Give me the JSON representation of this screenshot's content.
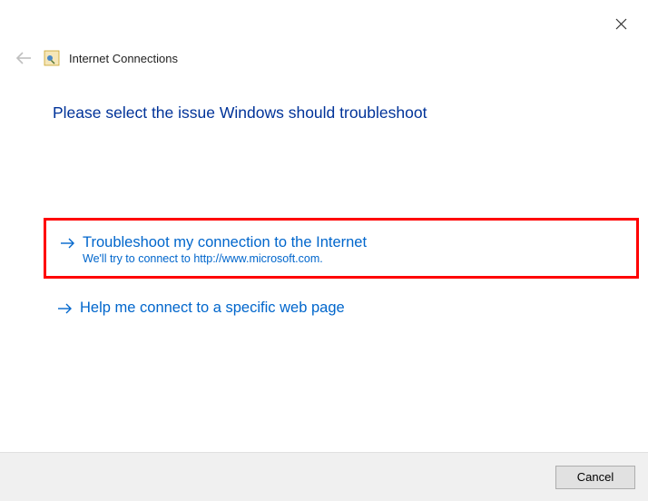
{
  "window_title": "Internet Connections",
  "heading": "Please select the issue Windows should troubleshoot",
  "options": [
    {
      "title": "Troubleshoot my connection to the Internet",
      "subtitle": "We'll try to connect to http://www.microsoft.com.",
      "highlighted": true
    },
    {
      "title": "Help me connect to a specific web page",
      "subtitle": "",
      "highlighted": false
    }
  ],
  "footer": {
    "cancel_label": "Cancel"
  }
}
